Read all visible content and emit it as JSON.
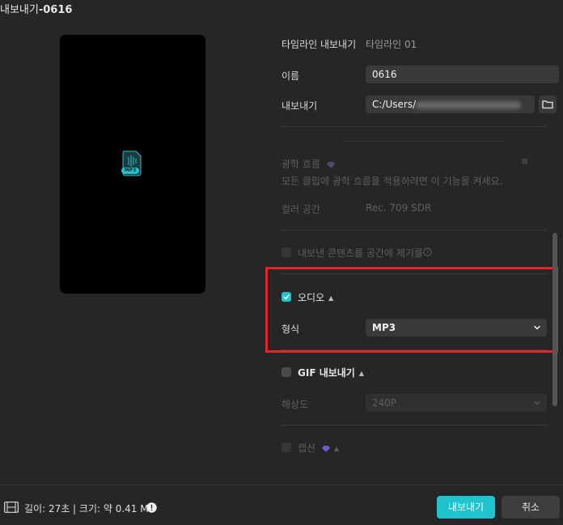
{
  "window": {
    "title_prefix": "내보내기",
    "title_name": "-0616"
  },
  "preview": {
    "file_badge": "MP3"
  },
  "timeline": {
    "label": "타임라인 내보내기",
    "value": "타임라인 01"
  },
  "name_field": {
    "label": "이름",
    "value": "0616"
  },
  "export_path": {
    "label": "내보내기",
    "value": "C:/Users/"
  },
  "optical_flow": {
    "label": "광학 흐름",
    "description": "모든 클립에 광학 흐름을 적용하려면 이 기능을 켜세요."
  },
  "color_space": {
    "label": "컬러 공간",
    "value": "Rec. 709 SDR"
  },
  "hdr_option": {
    "label": "내보낸 콘텐츠를 공간에 제기를"
  },
  "audio": {
    "label": "오디오",
    "checked": true,
    "format_label": "형식",
    "format_value": "MP3"
  },
  "gif": {
    "label": "GIF 내보내기",
    "checked": false,
    "resolution_label": "해상도",
    "resolution_value": "240P"
  },
  "captions": {
    "label": "캡션"
  },
  "footer": {
    "info": "길이: 27초 | 크기: 약 0.41 MB",
    "export_button": "내보내기",
    "cancel_button": "취소"
  },
  "colors": {
    "accent": "#1fc4cf",
    "highlight_box": "#e0262a"
  }
}
